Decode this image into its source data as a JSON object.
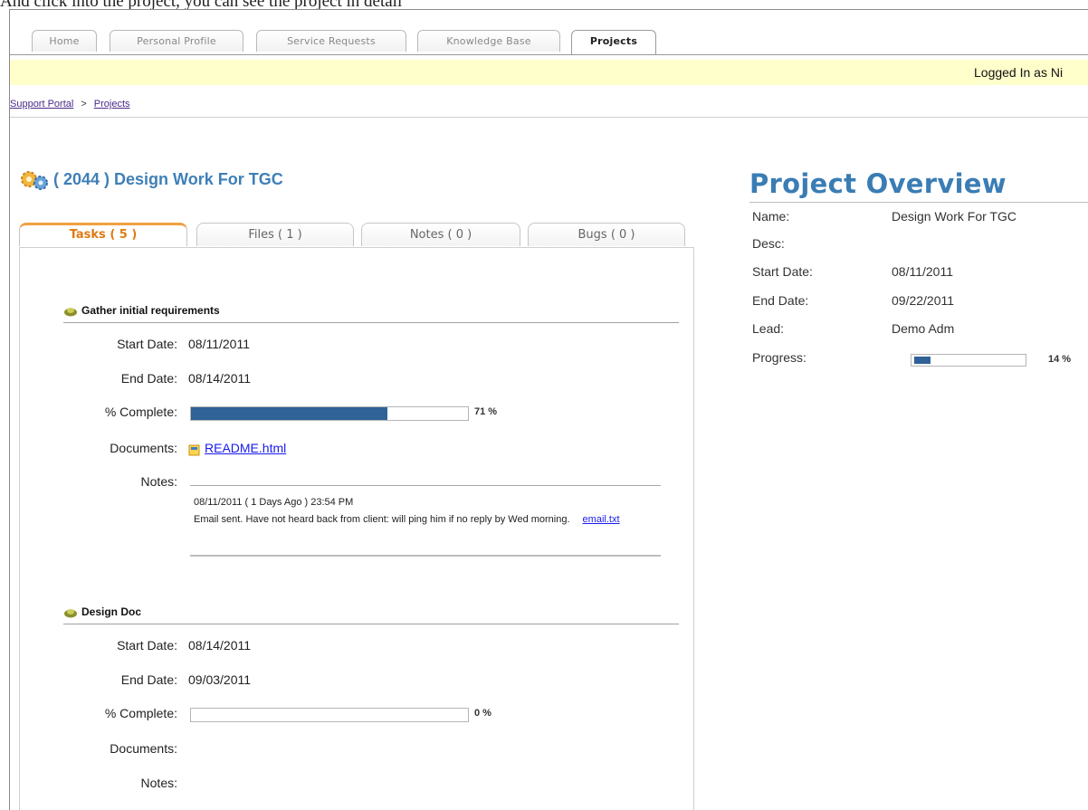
{
  "caption": "And click into the project, you can see the project in detail",
  "nav_tabs": [
    {
      "label": "Home"
    },
    {
      "label": "Personal Profile"
    },
    {
      "label": "Service Requests"
    },
    {
      "label": "Knowledge Base"
    },
    {
      "label": "Projects"
    }
  ],
  "active_tab": "Projects",
  "user_bar": {
    "text": "Logged In as Ni"
  },
  "breadcrumb": {
    "root": "Support Portal",
    "separator": ">",
    "current": "Projects"
  },
  "project": {
    "title": "( 2044 ) Design Work For TGC",
    "icon": "gears-icon"
  },
  "project_tabs": [
    {
      "label": "Tasks ( 5 )"
    },
    {
      "label": "Files ( 1 )"
    },
    {
      "label": "Notes ( 0 )"
    },
    {
      "label": "Bugs ( 0 )"
    }
  ],
  "labels": {
    "start_date": "Start Date:",
    "end_date": "End Date:",
    "complete": "% Complete:",
    "documents": "Documents:",
    "notes": "Notes:"
  },
  "tasks": [
    {
      "name": "Gather initial requirements",
      "start_date": "08/11/2011",
      "end_date": "08/14/2011",
      "percent": 71,
      "percent_label": "71 %",
      "document": "README.html",
      "note": {
        "when": "08/11/2011 ( 1 Days Ago ) 23:54 PM",
        "text": "Email sent. Have not heard back from client: will ping him if no reply by Wed morning.",
        "attachment": "email.txt"
      }
    },
    {
      "name": "Design Doc",
      "start_date": "08/14/2011",
      "end_date": "09/03/2011",
      "percent": 0,
      "percent_label": "0 %"
    }
  ],
  "overview": {
    "title": "Project Overview",
    "name_label": "Name:",
    "name": "Design Work For TGC",
    "desc_label": "Desc:",
    "start_label": "Start Date:",
    "start": "08/11/2011",
    "end_label": "End Date:",
    "end": "09/22/2011",
    "lead_label": "Lead:",
    "lead": "Demo Adm",
    "progress_label": "Progress:",
    "progress": 14,
    "progress_text": "14 %"
  },
  "colors": {
    "accent": "#3a7db4",
    "bar": "#2f6296",
    "active_tab": "#e07a12",
    "user_bar_bg": "#ffffcc"
  }
}
